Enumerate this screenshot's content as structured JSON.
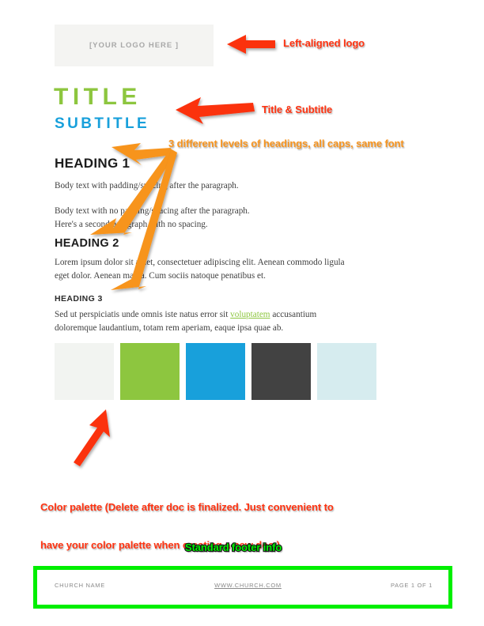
{
  "document": {
    "logo_placeholder": "[YOUR LOGO HERE ]",
    "title": "TITLE",
    "subtitle": "SUBTITLE",
    "heading_1": "HEADING 1",
    "heading_2": "HEADING 2",
    "heading_3": "HEADING 3",
    "body_1": "Body text with padding/spacing after the paragraph.",
    "body_2a": "Body text with no padding/spacing after the paragraph.",
    "body_2b": "Here's a second paragraph with no spacing.",
    "body_3": "Lorem ipsum dolor sit amet, consectetuer adipiscing elit. Aenean commodo ligula eget dolor. Aenean massa. Cum sociis natoque penatibus et.",
    "body_4_pre": "Sed ut perspiciatis unde omnis iste natus error sit ",
    "body_4_link": "voluptatem",
    "body_4_post": " accusantium doloremque laudantium, totam rem aperiam, eaque ipsa quae ab."
  },
  "palette": {
    "swatches": [
      {
        "name": "off-white",
        "hex": "#f2f4f1"
      },
      {
        "name": "green",
        "hex": "#8dc63f"
      },
      {
        "name": "blue",
        "hex": "#18a0db"
      },
      {
        "name": "dark-gray",
        "hex": "#424242"
      },
      {
        "name": "pale-cyan",
        "hex": "#d6ecef"
      }
    ]
  },
  "footer": {
    "left": "CHURCH NAME",
    "center": "WWW.CHURCH.COM",
    "right": "PAGE 1 OF 1",
    "border_color": "#00ef00"
  },
  "annotations": {
    "logo": "Left-aligned logo",
    "title": "Title & Subtitle",
    "headings": "3 different levels of headings, all caps, same font",
    "palette_line1": "Color palette (Delete after doc is finalized. Just convenient to",
    "palette_line2": "have your color palette when creating a new doc.)",
    "footer": "Standard footer info",
    "colors": {
      "red": "#ff3311",
      "orange": "#f7941e",
      "green": "#00ef00"
    }
  },
  "theme": {
    "title_color": "#8dc63f",
    "subtitle_color": "#18a0db",
    "link_color": "#8dc63f",
    "body_color": "#3f3f3f"
  }
}
